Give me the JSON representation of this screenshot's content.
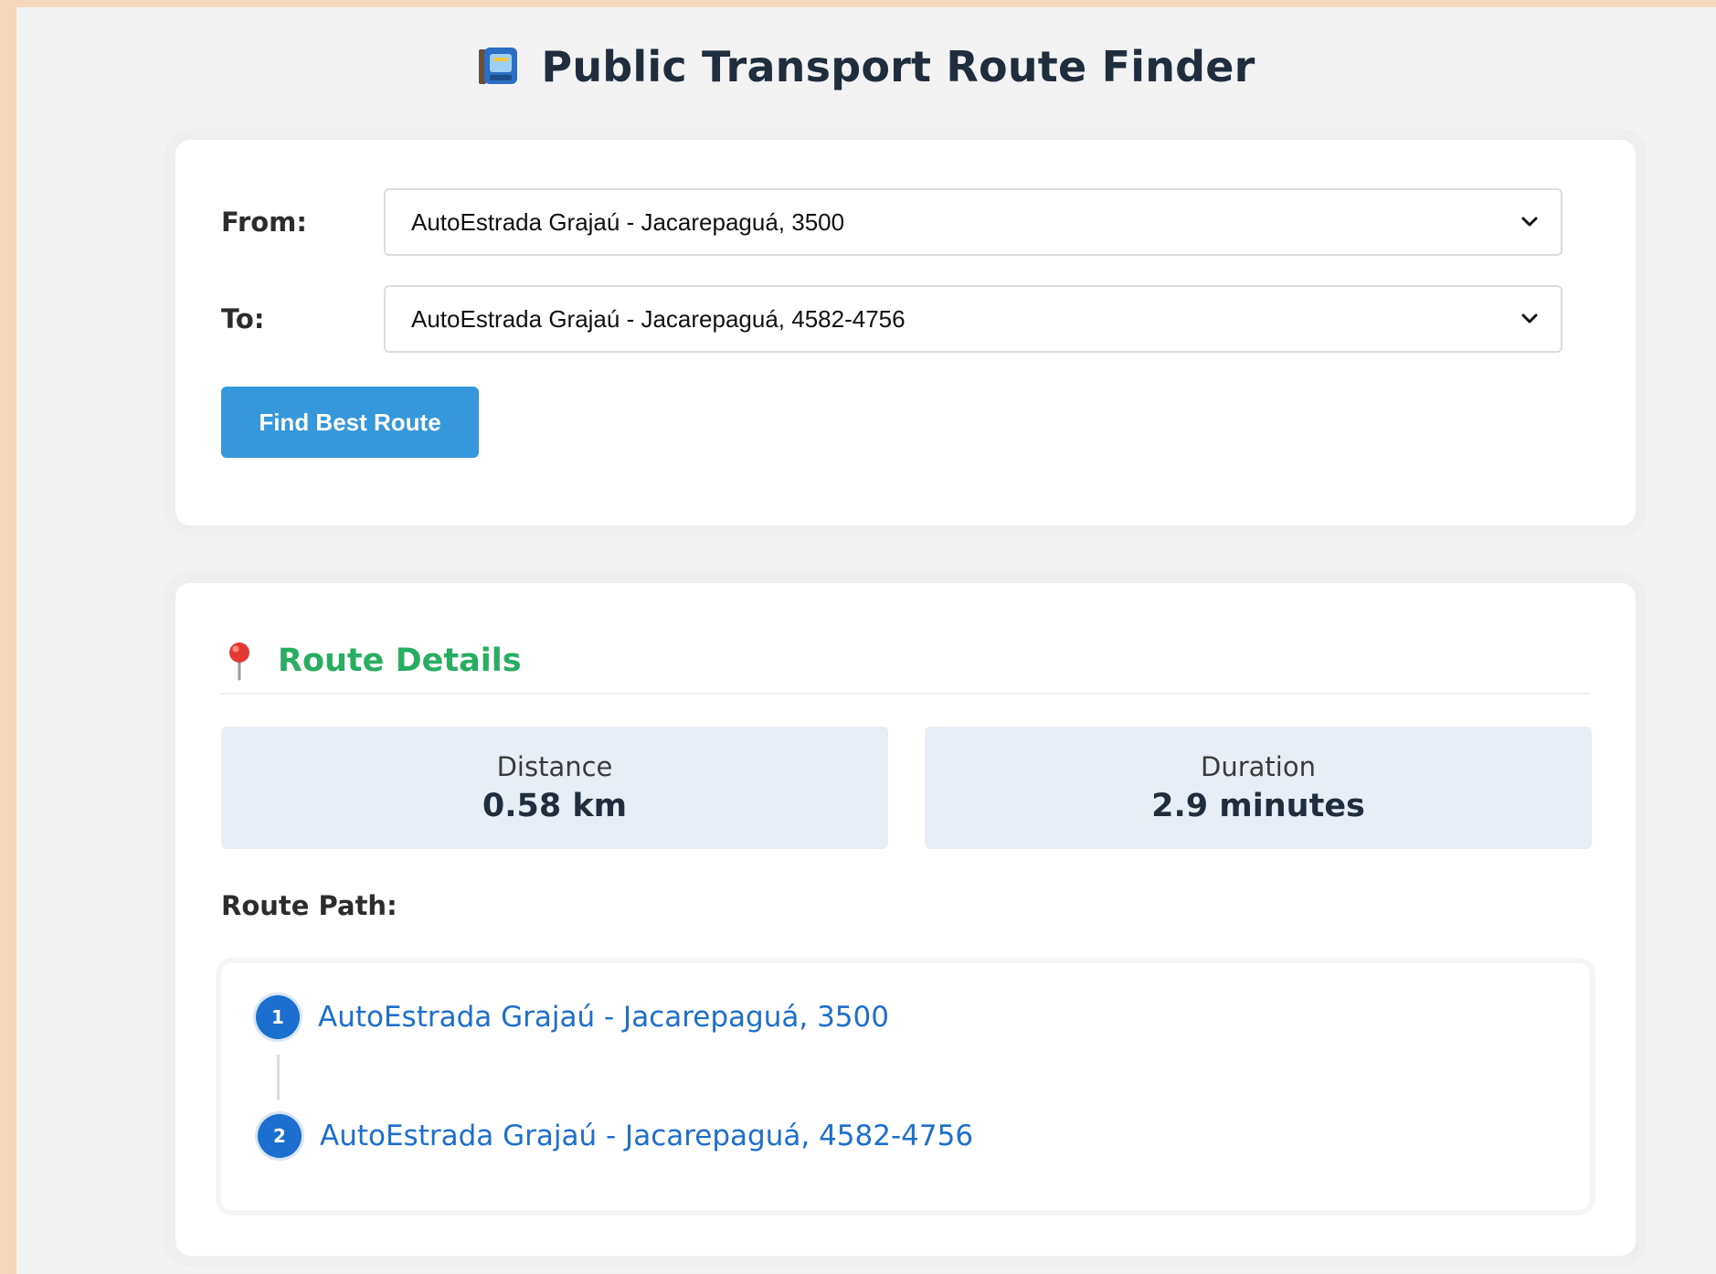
{
  "header": {
    "title": "Public Transport Route Finder",
    "icon": "tram-icon"
  },
  "form": {
    "from_label": "From:",
    "from_value": "AutoEstrada Grajaú - Jacarepaguá, 3500",
    "to_label": "To:",
    "to_value": "AutoEstrada Grajaú - Jacarepaguá, 4582-4756",
    "submit_label": "Find Best Route"
  },
  "details": {
    "title": "Route Details",
    "icon": "pin-icon",
    "distance_label": "Distance",
    "distance_value": "0.58 km",
    "duration_label": "Duration",
    "duration_value": "2.9 minutes",
    "route_path_label": "Route Path:",
    "steps": [
      {
        "number": "1",
        "name": "AutoEstrada Grajaú - Jacarepaguá, 3500"
      },
      {
        "number": "2",
        "name": "AutoEstrada Grajaú - Jacarepaguá, 4582-4756"
      }
    ]
  },
  "colors": {
    "outer_background": "#f5d7bc",
    "page_background": "#f3f3f3",
    "primary_button": "#3498db",
    "details_title": "#27ae60",
    "step_accent": "#1d6fcf",
    "stat_background": "#e8eef5"
  }
}
